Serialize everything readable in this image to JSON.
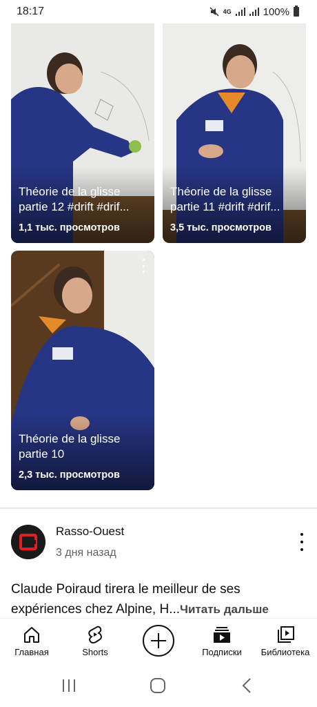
{
  "status_bar": {
    "time": "18:17",
    "network_type": "4G",
    "battery": "100%"
  },
  "shorts": [
    {
      "title_line1": "Théorie de la glisse",
      "title_line2": "partie 12 #drift #drif...",
      "views": "1,1 тыс. просмотров"
    },
    {
      "title_line1": "Théorie de la glisse",
      "title_line2": "partie 11 #drift #drif...",
      "views": "3,5 тыс. просмотров"
    },
    {
      "title_line1": "Théorie de la glisse",
      "title_line2": "partie 10",
      "views": "2,3 тыс. просмотров"
    }
  ],
  "post": {
    "channel": "Rasso-Ouest",
    "time": "3 дня назад",
    "text": "Claude Poiraud tirera le meilleur de ses expériences chez Alpine, H...",
    "read_more": "Читать дальше"
  },
  "bottom_nav": {
    "home": "Главная",
    "shorts": "Shorts",
    "subscriptions": "Подписки",
    "library": "Библиотека"
  },
  "icons": {
    "home": "home-icon",
    "shorts": "shorts-icon",
    "create": "create-icon",
    "subscriptions": "subscriptions-icon",
    "library": "library-icon"
  },
  "colors": {
    "jacket": "#1f2a6b",
    "wall": "#f0f0ee",
    "wood": "#5a3a1e",
    "avatar_red": "#e02020"
  }
}
